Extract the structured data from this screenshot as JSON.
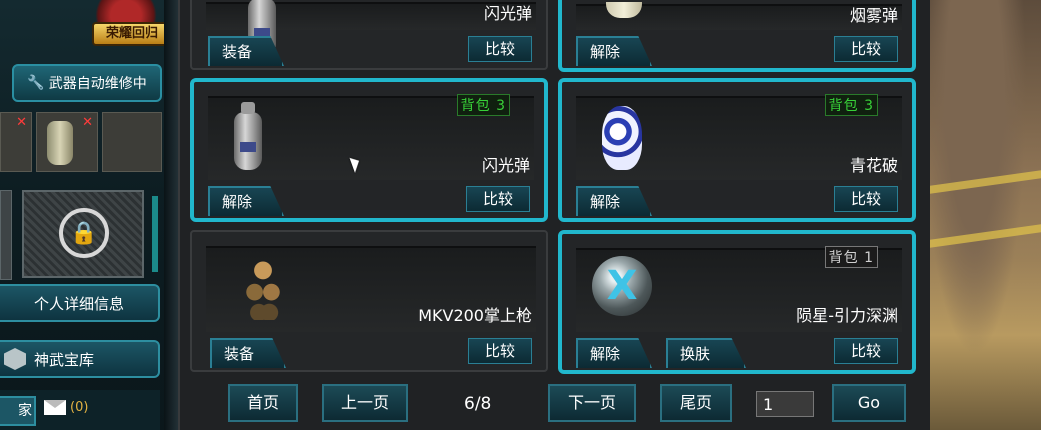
{
  "sidebar": {
    "badge_label": "荣耀回归",
    "repair_label": "武器自动维修中",
    "profile_label": "个人详细信息",
    "treasury_label": "神武宝库",
    "home_label": "家",
    "mail_count": "(0)"
  },
  "cards": [
    {
      "name": "闪光弹",
      "action_label": "装备",
      "compare_label": "比较"
    },
    {
      "name": "烟雾弹",
      "action_label": "解除",
      "compare_label": "比较"
    },
    {
      "name": "闪光弹",
      "tag": "背包 3",
      "action_label": "解除",
      "compare_label": "比较"
    },
    {
      "name": "青花破",
      "tag": "背包 3",
      "action_label": "解除",
      "compare_label": "比较"
    },
    {
      "name": "MKV200掌上枪",
      "action_label": "装备",
      "compare_label": "比较"
    },
    {
      "name": "陨星-引力深渊",
      "tag": "背包 1",
      "action_label": "解除",
      "extra_label": "换肤",
      "compare_label": "比较"
    }
  ],
  "pagination": {
    "first": "首页",
    "prev": "上一页",
    "page_indicator": "6/8",
    "next": "下一页",
    "last": "尾页",
    "page_input_value": "1",
    "go": "Go"
  },
  "colors": {
    "selected_border": "#21b7cc",
    "tag_green": "#38d038"
  }
}
